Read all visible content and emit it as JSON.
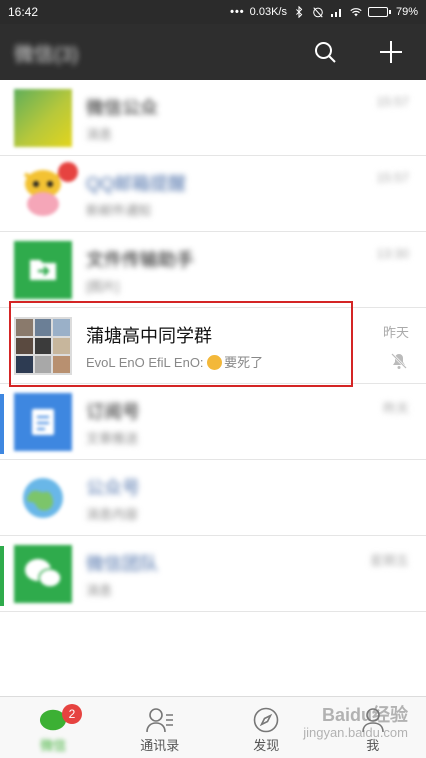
{
  "status_bar": {
    "time": "16:42",
    "dots": "•••",
    "network_speed": "0.03K/s",
    "battery_percent": "79%",
    "battery_level": 0.79
  },
  "header": {
    "title": "微信(3)",
    "search_icon": "search-icon",
    "add_icon": "plus-icon"
  },
  "chats": [
    {
      "name": "微信公众",
      "preview": "消息",
      "time": "15:57",
      "avatar": "green-yellow-gradient"
    },
    {
      "name": "QQ邮箱提醒",
      "preview": "新邮件通知",
      "time": "15:57",
      "avatar": "cartoon-cow"
    },
    {
      "name": "文件传输助手",
      "preview": "[图片]",
      "time": "13:30",
      "avatar": "file-transfer-icon"
    },
    {
      "name": "蒲塘高中同学群",
      "preview": "EvoL EnO EfiL EnO: ",
      "preview_suffix": "要死了",
      "time": "昨天",
      "avatar": "group-collage",
      "muted": true
    },
    {
      "name": "订阅号",
      "preview": "文章推送",
      "time": "昨天",
      "avatar": "subscription-icon"
    },
    {
      "name": "公众号",
      "preview": "消息内容",
      "time": "",
      "avatar": "globe-icon"
    },
    {
      "name": "微信团队",
      "preview": "消息",
      "time": "星期五",
      "avatar": "wechat-logo"
    }
  ],
  "tabs": [
    {
      "label": "微信",
      "badge": "2",
      "icon": "chat-icon"
    },
    {
      "label": "通讯录",
      "icon": "contacts-icon"
    },
    {
      "label": "发现",
      "icon": "compass-icon"
    },
    {
      "label": "我",
      "icon": "person-icon"
    }
  ],
  "watermark": {
    "line1": "Baidu经验",
    "line2": "jingyan.baidu.com"
  },
  "colors": {
    "header_bg": "#2e2e2e",
    "highlight_border": "#d42525",
    "badge_red": "#e64340",
    "wechat_green": "#3cb034"
  }
}
